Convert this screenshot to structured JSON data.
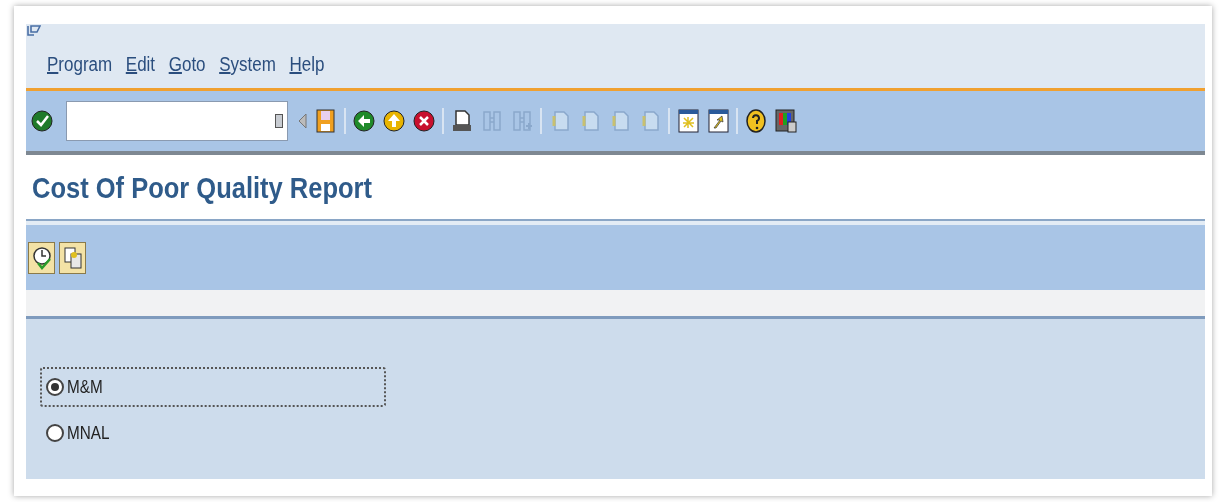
{
  "menu": [
    {
      "label": "Program"
    },
    {
      "label": "Edit"
    },
    {
      "label": "Goto"
    },
    {
      "label": "System"
    },
    {
      "label": "Help"
    }
  ],
  "title": "Cost Of Poor Quality Report",
  "options": [
    {
      "label": "M&M",
      "selected": true,
      "focused": true
    },
    {
      "label": "MNAL",
      "selected": false,
      "focused": false
    }
  ]
}
